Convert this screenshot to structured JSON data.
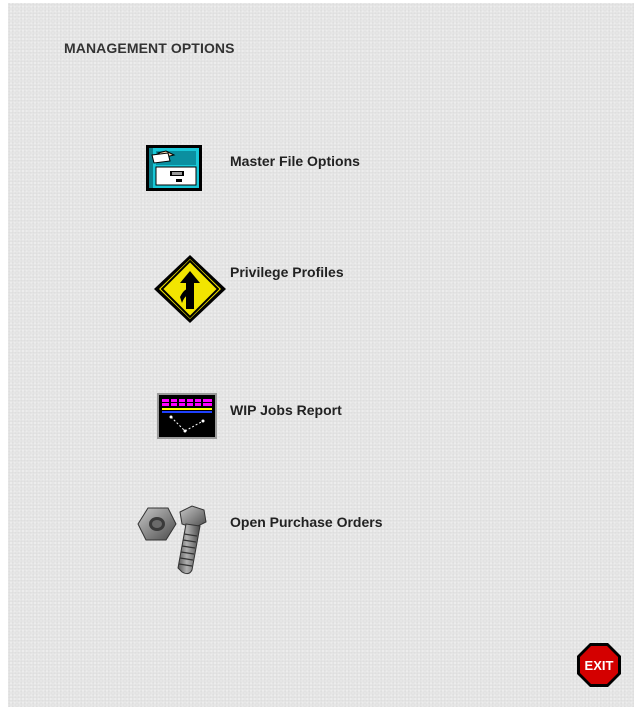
{
  "heading": "MANAGEMENT OPTIONS",
  "menu": {
    "items": [
      {
        "label": "Master File Options",
        "icon": "filing-cabinet-icon"
      },
      {
        "label": "Privilege Profiles",
        "icon": "merge-sign-icon"
      },
      {
        "label": "WIP Jobs Report",
        "icon": "report-chart-icon"
      },
      {
        "label": "Open Purchase Orders",
        "icon": "nut-bolt-icon"
      }
    ]
  },
  "exit": {
    "label": "EXIT",
    "icon": "stop-sign-icon"
  },
  "colors": {
    "background": "#e6e6e6",
    "exit_red": "#d40000",
    "sign_yellow": "#f0e000",
    "cabinet_cyan": "#18c8d8"
  }
}
